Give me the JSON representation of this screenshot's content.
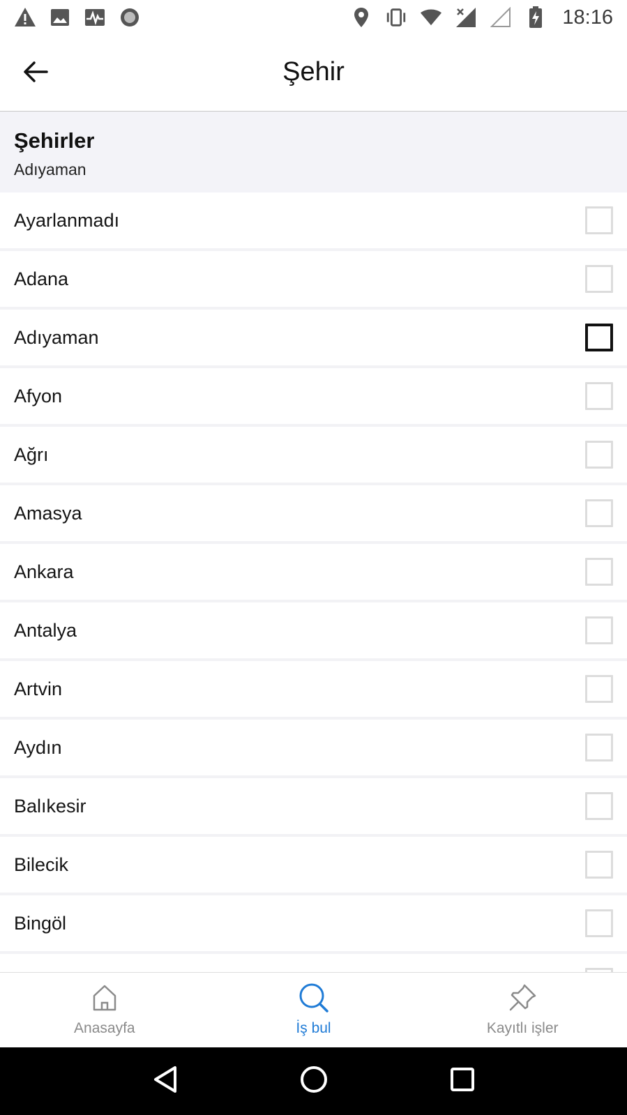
{
  "status_bar": {
    "time": "18:16",
    "left_icons": [
      "warning-icon",
      "image-icon",
      "pulse-icon",
      "record-icon"
    ],
    "right_icons": [
      "location-icon",
      "vibrate-icon",
      "wifi-icon",
      "signal-icon",
      "signal-empty-icon",
      "battery-charging-icon"
    ]
  },
  "app_bar": {
    "title": "Şehir",
    "back_icon": "arrow-left-icon"
  },
  "section": {
    "title": "Şehirler",
    "selected": "Adıyaman"
  },
  "cities": [
    {
      "label": "Ayarlanmadı",
      "checked": false,
      "focused": false
    },
    {
      "label": "Adana",
      "checked": false,
      "focused": false
    },
    {
      "label": "Adıyaman",
      "checked": false,
      "focused": true
    },
    {
      "label": "Afyon",
      "checked": false,
      "focused": false
    },
    {
      "label": "Ağrı",
      "checked": false,
      "focused": false
    },
    {
      "label": "Amasya",
      "checked": false,
      "focused": false
    },
    {
      "label": "Ankara",
      "checked": false,
      "focused": false
    },
    {
      "label": "Antalya",
      "checked": false,
      "focused": false
    },
    {
      "label": "Artvin",
      "checked": false,
      "focused": false
    },
    {
      "label": "Aydın",
      "checked": false,
      "focused": false
    },
    {
      "label": "Balıkesir",
      "checked": false,
      "focused": false
    },
    {
      "label": "Bilecik",
      "checked": false,
      "focused": false
    },
    {
      "label": "Bingöl",
      "checked": false,
      "focused": false
    },
    {
      "label": "",
      "checked": false,
      "focused": false
    }
  ],
  "bottom_nav": [
    {
      "label": "Anasayfa",
      "icon": "home-icon",
      "active": false
    },
    {
      "label": "İş bul",
      "icon": "search-icon",
      "active": true
    },
    {
      "label": "Kayıtlı işler",
      "icon": "pin-icon",
      "active": false
    }
  ],
  "colors": {
    "accent": "#1f7bd6",
    "inactive": "#8a8a8a",
    "header_bg": "#f3f3f8",
    "checkbox_border": "#dcdcdc"
  }
}
